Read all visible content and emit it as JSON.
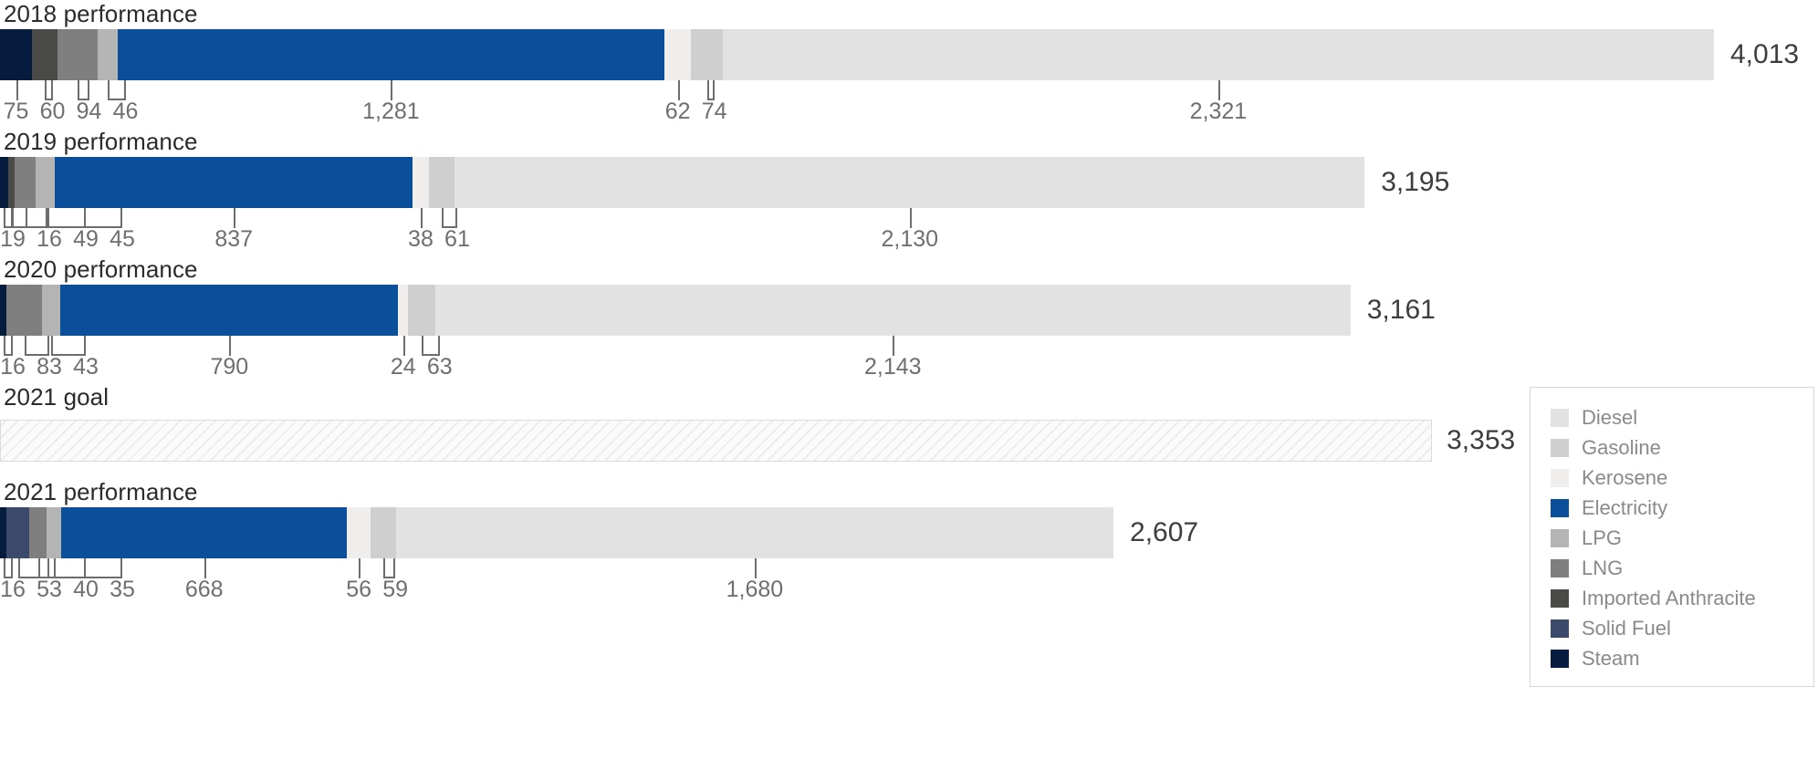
{
  "palette": {
    "steam": "#061c3f",
    "solid_fuel": "#3b4a6b",
    "imported_anthracite": "#4a4a48",
    "lng": "#7f7f7f",
    "lpg": "#b4b4b4",
    "electricity": "#0b4f9a",
    "kerosene": "#efeeec",
    "gasoline": "#cfcfcf",
    "diesel": "#e2e2e2",
    "goal_outline": "#dcdcdc",
    "title_text": "#2b2b2b",
    "value_text": "#6f6f6f",
    "total_text": "#3d3d3d",
    "legend_text": "#8a8a8a",
    "leader_line": "#6d6d6d"
  },
  "legend": {
    "items": [
      {
        "label": "Diesel",
        "color_key": "diesel"
      },
      {
        "label": "Gasoline",
        "color_key": "gasoline"
      },
      {
        "label": "Kerosene",
        "color_key": "kerosene"
      },
      {
        "label": "Electricity",
        "color_key": "electricity"
      },
      {
        "label": "LPG",
        "color_key": "lpg"
      },
      {
        "label": "LNG",
        "color_key": "lng"
      },
      {
        "label": "Imported Anthracite",
        "color_key": "imported_anthracite"
      },
      {
        "label": "Solid Fuel",
        "color_key": "solid_fuel"
      },
      {
        "label": "Steam",
        "color_key": "steam"
      }
    ]
  },
  "chart_data": {
    "type": "bar",
    "subtype": "stacked-horizontal",
    "title": "",
    "xlabel": "",
    "ylabel": "",
    "grid": false,
    "legend_position": "right",
    "categories": [
      "2018 performance",
      "2019 performance",
      "2020 performance",
      "2021 goal",
      "2021 performance"
    ],
    "series": [
      {
        "name": "Steam",
        "values": [
          75,
          19,
          16,
          null,
          16
        ]
      },
      {
        "name": "Solid Fuel",
        "values": [
          null,
          null,
          null,
          null,
          53
        ]
      },
      {
        "name": "Imported Anthracite",
        "values": [
          60,
          16,
          null,
          null,
          null
        ]
      },
      {
        "name": "LNG",
        "values": [
          94,
          49,
          83,
          null,
          40
        ]
      },
      {
        "name": "LPG",
        "values": [
          46,
          45,
          43,
          null,
          35
        ]
      },
      {
        "name": "Electricity",
        "values": [
          1281,
          837,
          790,
          null,
          668
        ]
      },
      {
        "name": "Kerosene",
        "values": [
          62,
          38,
          24,
          null,
          56
        ]
      },
      {
        "name": "Gasoline",
        "values": [
          74,
          61,
          63,
          null,
          59
        ]
      },
      {
        "name": "Diesel",
        "values": [
          2321,
          2130,
          2143,
          null,
          1680
        ]
      }
    ],
    "totals": [
      4013,
      3195,
      3161,
      3353,
      2607
    ],
    "total_labels": [
      "4,013",
      "3,195",
      "3,161",
      "3,353",
      "2,607"
    ]
  },
  "groups": [
    {
      "title": "2018 performance",
      "total_label": "4,013",
      "goal": false,
      "segments": [
        {
          "key": "steam",
          "value_label": "75"
        },
        {
          "key": "imported_anthracite",
          "value_label": "60"
        },
        {
          "key": "lng",
          "value_label": "94"
        },
        {
          "key": "lpg",
          "value_label": "46"
        },
        {
          "key": "electricity",
          "value_label": "1,281"
        },
        {
          "key": "kerosene",
          "value_label": "62"
        },
        {
          "key": "gasoline",
          "value_label": "74"
        },
        {
          "key": "diesel",
          "value_label": "2,321"
        }
      ]
    },
    {
      "title": "2019 performance",
      "total_label": "3,195",
      "goal": false,
      "segments": [
        {
          "key": "steam",
          "value_label": "19"
        },
        {
          "key": "imported_anthracite",
          "value_label": "16"
        },
        {
          "key": "lng",
          "value_label": "49"
        },
        {
          "key": "lpg",
          "value_label": "45"
        },
        {
          "key": "electricity",
          "value_label": "837"
        },
        {
          "key": "kerosene",
          "value_label": "38"
        },
        {
          "key": "gasoline",
          "value_label": "61"
        },
        {
          "key": "diesel",
          "value_label": "2,130"
        }
      ]
    },
    {
      "title": "2020 performance",
      "total_label": "3,161",
      "goal": false,
      "segments": [
        {
          "key": "steam",
          "value_label": "16"
        },
        {
          "key": "lng",
          "value_label": "83"
        },
        {
          "key": "lpg",
          "value_label": "43"
        },
        {
          "key": "electricity",
          "value_label": "790"
        },
        {
          "key": "kerosene",
          "value_label": "24"
        },
        {
          "key": "gasoline",
          "value_label": "63"
        },
        {
          "key": "diesel",
          "value_label": "2,143"
        }
      ]
    },
    {
      "title": "2021 goal",
      "total_label": "3,353",
      "goal": true,
      "segments": []
    },
    {
      "title": "2021 performance",
      "total_label": "2,607",
      "goal": false,
      "segments": [
        {
          "key": "steam",
          "value_label": "16"
        },
        {
          "key": "solid_fuel",
          "value_label": "53"
        },
        {
          "key": "lng",
          "value_label": "40"
        },
        {
          "key": "lpg",
          "value_label": "35"
        },
        {
          "key": "electricity",
          "value_label": "668"
        },
        {
          "key": "kerosene",
          "value_label": "56"
        },
        {
          "key": "gasoline",
          "value_label": "59"
        },
        {
          "key": "diesel",
          "value_label": "1,680"
        }
      ]
    }
  ]
}
